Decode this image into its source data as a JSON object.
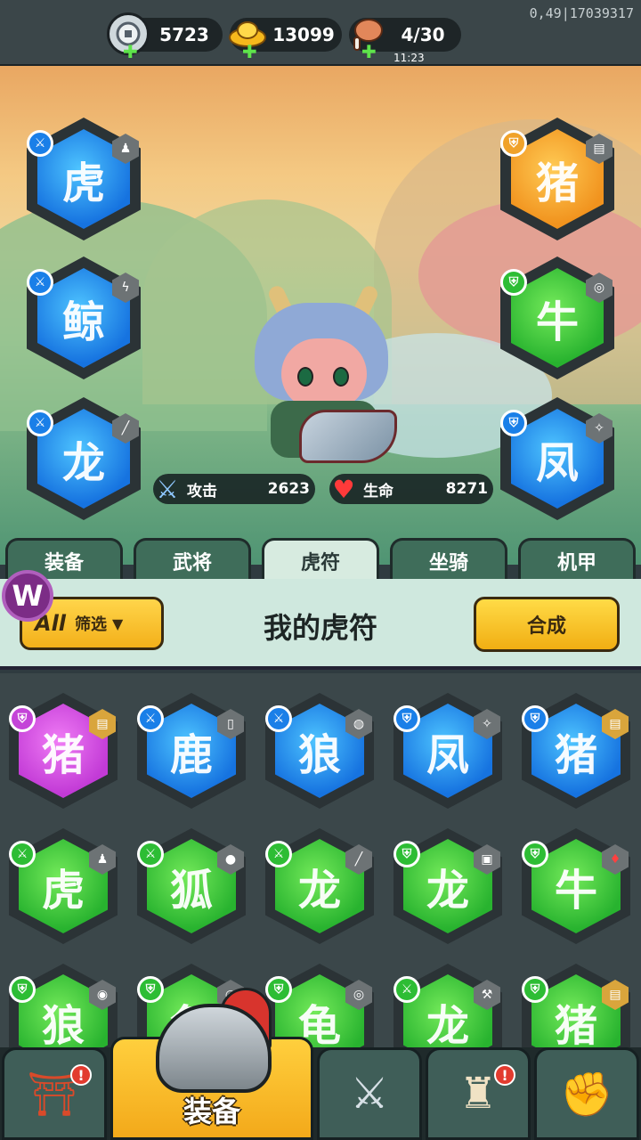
{
  "version": "0,49|17039317",
  "resources": [
    {
      "name": "silver",
      "value": "5723",
      "icon": "silver-coin-icon"
    },
    {
      "name": "gold",
      "value": "13099",
      "icon": "gold-ingot-icon"
    },
    {
      "name": "stamina",
      "value": "4/30",
      "icon": "meat-icon",
      "timer": "11:23"
    }
  ],
  "hero": {
    "attack_label": "攻击",
    "attack_value": "2623",
    "hp_label": "生命",
    "hp_value": "8271"
  },
  "equipped": [
    {
      "rarity": "blue",
      "glyph": "虎",
      "slot": "tiger-left"
    },
    {
      "rarity": "blue",
      "glyph": "鲸",
      "slot": "whale-left"
    },
    {
      "rarity": "blue",
      "glyph": "龙",
      "slot": "dragon-left"
    },
    {
      "rarity": "orange",
      "glyph": "猪",
      "slot": "boar-right"
    },
    {
      "rarity": "green",
      "glyph": "牛",
      "slot": "bull-right"
    },
    {
      "rarity": "blue",
      "glyph": "凤",
      "slot": "phoenix-right"
    }
  ],
  "tabs": [
    "装备",
    "武将",
    "虎符",
    "坐骑",
    "机甲"
  ],
  "active_tab": "虎符",
  "filter": {
    "all_label": "All",
    "filter_label": "筛选",
    "arrow": "▼"
  },
  "page_title": "我的虎符",
  "synth_button": "合成",
  "brand_logo": "W",
  "inventory": [
    {
      "rarity": "purple",
      "glyph": "猪"
    },
    {
      "rarity": "blue",
      "glyph": "鹿"
    },
    {
      "rarity": "blue",
      "glyph": "狼"
    },
    {
      "rarity": "blue",
      "glyph": "凤"
    },
    {
      "rarity": "blue",
      "glyph": "猪"
    },
    {
      "rarity": "green",
      "glyph": "虎"
    },
    {
      "rarity": "green",
      "glyph": "狐"
    },
    {
      "rarity": "green",
      "glyph": "龙"
    },
    {
      "rarity": "green",
      "glyph": "龙"
    },
    {
      "rarity": "green",
      "glyph": "牛"
    },
    {
      "rarity": "green",
      "glyph": "狼"
    },
    {
      "rarity": "green",
      "glyph": "龟"
    },
    {
      "rarity": "green",
      "glyph": "龟"
    },
    {
      "rarity": "green",
      "glyph": "龙"
    },
    {
      "rarity": "green",
      "glyph": "猪"
    }
  ],
  "bottom_nav": [
    {
      "name": "shop",
      "icon": "shop-icon",
      "alert": "!"
    },
    {
      "name": "equipment",
      "label": "装备",
      "icon": "helmet-icon"
    },
    {
      "name": "battle",
      "icon": "crossed-swords-icon"
    },
    {
      "name": "heroes",
      "icon": "horn-helmet-icon",
      "alert": "!"
    },
    {
      "name": "upgrade",
      "icon": "fist-upgrade-icon"
    }
  ]
}
